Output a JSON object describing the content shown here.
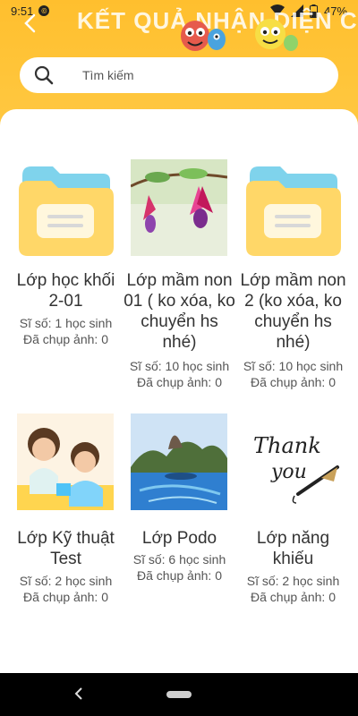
{
  "status": {
    "time": "9:51",
    "app_badge": "©",
    "battery": "47%",
    "icons": [
      "wifi-icon",
      "signal-icon",
      "battery-icon"
    ]
  },
  "header": {
    "title": "KẾT QUẢ NHẬN DIỆN CÁC LỚP",
    "back_icon": "back-arrow-icon"
  },
  "search": {
    "placeholder": "Tìm kiếm"
  },
  "classes": [
    {
      "title": "Lớp học khối 2-01",
      "students": "Sĩ số: 1 học sinh",
      "photos": "Đã chụp ảnh: 0",
      "thumb": "folder"
    },
    {
      "title": "Lớp mầm non 01 ( ko xóa, ko chuyển hs nhé)",
      "students": "Sĩ số: 10 học sinh",
      "photos": "Đã chụp ảnh: 0",
      "thumb": "flower-photo"
    },
    {
      "title": "Lớp mầm non 2 (ko xóa, ko chuyển hs nhé)",
      "students": "Sĩ số: 10 học sinh",
      "photos": "Đã chụp ảnh: 0",
      "thumb": "folder"
    },
    {
      "title": "Lớp Kỹ thuật Test",
      "students": "Sĩ số: 2 học sinh",
      "photos": "Đã chụp ảnh: 0",
      "thumb": "kids-photo"
    },
    {
      "title": "Lớp Podo",
      "students": "Sĩ số: 6 học sinh",
      "photos": "Đã chụp ảnh: 0",
      "thumb": "landscape-photo"
    },
    {
      "title": "Lớp năng khiếu",
      "students": "Sĩ số: 2 học sinh",
      "photos": "Đã chụp ảnh: 0",
      "thumb": "thank-you-photo",
      "thumb_text_1": "Thank",
      "thumb_text_2": "you"
    }
  ],
  "colors": {
    "header": "#ffc53a",
    "folder_back": "#7fd3ec",
    "folder_front": "#ffd768"
  }
}
